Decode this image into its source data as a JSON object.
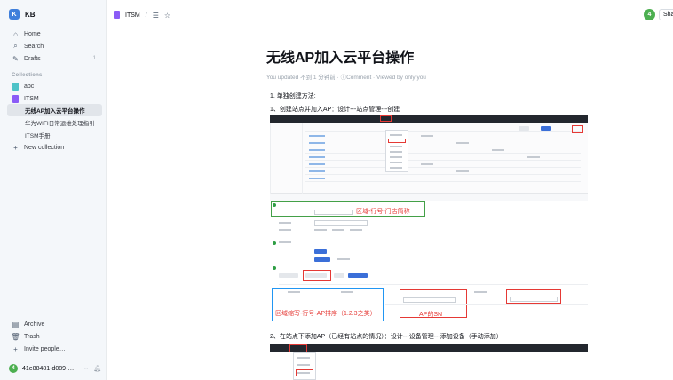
{
  "sidebar": {
    "team_logo": "K",
    "team_name": "KB",
    "nav": [
      {
        "label": "Home",
        "icon": "home-icon"
      },
      {
        "label": "Search",
        "icon": "search-icon"
      },
      {
        "label": "Drafts",
        "icon": "edit-icon",
        "count": "1"
      }
    ],
    "collections_label": "Collections",
    "collections": [
      {
        "label": "abc",
        "color": "#4ec3c8"
      },
      {
        "label": "ITSM",
        "color": "#8b5cf6"
      }
    ],
    "docs": [
      {
        "label": "无线AP加入云平台操作",
        "active": true
      },
      {
        "label": "华为WIFI日常运维处理指引",
        "active": false
      },
      {
        "label": "ITSM手册",
        "active": false
      }
    ],
    "new_collection": "New collection",
    "bottom": [
      {
        "label": "Archive",
        "icon": "archive-icon"
      },
      {
        "label": "Trash",
        "icon": "trash-icon"
      },
      {
        "label": "Invite people…",
        "icon": "plus-icon"
      }
    ],
    "user": {
      "initial": "4",
      "name": "41e88481-d089-…",
      "more": "···"
    }
  },
  "header": {
    "collection": "ITSM",
    "separator": "/",
    "menu_glyph": "☰",
    "star_glyph": "☆",
    "avatar_initial": "4",
    "share": "Share"
  },
  "doc": {
    "title": "无线AP加入云平台操作",
    "meta": "You updated 不到 1 分钟前 · ⓘComment · Viewed by only you",
    "p1": "1. 单独创建方法:",
    "p2": "1、创建站点并加入AP：设计---站点管理---创建",
    "p3": "2、在站点下添加AP（已经有站点的情况）：设计---设备管理---添加设备（手动添加）"
  },
  "shot1": {
    "annot_region": "区域-行号-门店简称",
    "annot_name": "区域缩写-行号-AP排序（1.2.3之类）",
    "annot_sn": "AP的SN"
  },
  "colors": {
    "accent": "#3f7fdb",
    "annot_red": "#e53935",
    "annot_green": "#43a047",
    "annot_blue": "#2196f3"
  }
}
